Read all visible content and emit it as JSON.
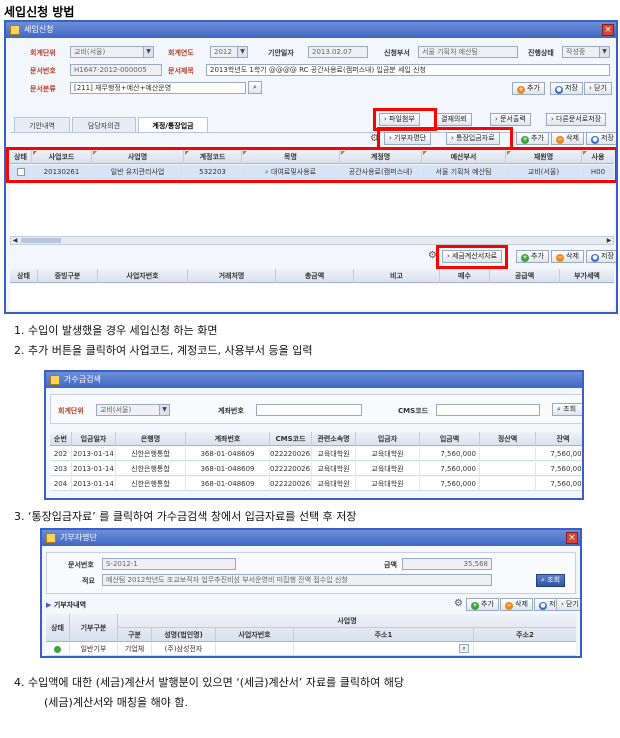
{
  "doc_title": "세입신청 방법",
  "main_window": {
    "title": "세입신청",
    "fields": {
      "unit_label": "회계단위",
      "unit_value": "교비(서울)",
      "year_label": "회계연도",
      "year_value": "2012",
      "date_label": "기안일자",
      "date_value": "2013.02.07",
      "dept_label": "신청부서",
      "dept_value": "서울 기획처 예산팀",
      "status_label": "진행상태",
      "status_value": "작성중",
      "docno_label": "문서번호",
      "docno_value": "H1647-2012-000005",
      "subject_label": "문서제목",
      "subject_value": "2013학년도 1학기 @@@@ RC 공간사용료(캠퍼스내) 입금분 세입 신청",
      "class_label": "문서분류",
      "class_value": "[211] 재무행정+예산+예산운영"
    },
    "buttons": {
      "add": "추가",
      "save": "저장",
      "close": "닫기",
      "attach": "파일첨부",
      "approval": "결재의뢰",
      "print": "문서출력",
      "other_save": "다른문서로저장",
      "donor": "기부자명단",
      "deposit": "통장입금자료",
      "grid_add": "추가",
      "grid_delete": "삭제",
      "grid_save": "저장",
      "tax": "세금계산서자료",
      "tax_add": "추가",
      "tax_delete": "삭제",
      "tax_save": "저장"
    },
    "tabs": [
      "기안내역",
      "담당자의견",
      "계정/통장입금"
    ],
    "grid_headers": [
      "상태",
      "사업코드",
      "사업명",
      "계정코드",
      "목명",
      "계정명",
      "예산부서",
      "재원명",
      "사용"
    ],
    "grid_row": [
      "",
      "20130261",
      "일반 유지관리사업",
      "532203",
      "대여료및사용료",
      "공간사용료(캠퍼스내)",
      "서울 기획처 예산팀",
      "교비(서울)",
      "H00"
    ],
    "tax_headers": [
      "상태",
      "증빙구분",
      "사업자번호",
      "거래처명",
      "총금액",
      "비고",
      "매수",
      "공급액",
      "부가세액"
    ]
  },
  "steps": {
    "s1": "1. 수입이 발생했을 경우 세입신청 하는 화면",
    "s2": "2. 추가 버튼을 클릭하여 사업코드, 계정코드, 사용부서 등을 입력",
    "s3": "3. ‘통장입금자료’ 를 클릭하여 가수금검색 창에서 입금자료를 선택 후 저장",
    "s4a": "4. 수입액에 대한 (세금)계산서 발행분이 있으면 ‘(세금)계산서’ 자료를 클릭하여 해당",
    "s4b": "(세금)계산서와 매칭을 해야 함."
  },
  "suspense_window": {
    "title": "가수금검색",
    "unit_label": "회계단위",
    "unit_value": "교비(서울)",
    "account_label": "계좌번호",
    "cms_label": "CMS코드",
    "search": "조회",
    "headers": [
      "순번",
      "입금일자",
      "은행명",
      "계좌번호",
      "CMS코드",
      "관련소속명",
      "입금자",
      "입금액",
      "정산액",
      "잔액"
    ],
    "rows": [
      [
        "202",
        "2013-01-14",
        "신한은행통합",
        "368-01-048609",
        "0222200262",
        "교육대학원",
        "교육대학원",
        "7,560,000",
        "",
        "7,560,000"
      ],
      [
        "203",
        "2013-01-14",
        "신한은행통합",
        "368-01-048609",
        "0222200262",
        "교육대학원",
        "교육대학원",
        "7,560,000",
        "",
        "7,560,000"
      ],
      [
        "204",
        "2013-01-14",
        "신한은행통합",
        "368-01-048609",
        "0222200262",
        "교육대학원",
        "교육대학원",
        "7,560,000",
        "",
        "7,560,000"
      ]
    ]
  },
  "donor_window": {
    "title": "기부자명단",
    "docno_label": "문서번호",
    "docno_value": "S-2012-1",
    "amount_label": "금액",
    "amount_value": "35,568",
    "summary_label": "적요",
    "summary_value": "예산팀 2012학년도 조교보직자 업무추진비성 부서운영비 미집행 잔액 접수입 신청",
    "search": "조회",
    "section": "기부자내역",
    "btn_add": "추가",
    "btn_delete": "삭제",
    "btn_save": "저장",
    "btn_close": "닫기",
    "top_header": "사업명",
    "headers": [
      "상태",
      "기부구분",
      "구분",
      "성명(법인명)",
      "사업자번호",
      "주소1",
      "주소2"
    ],
    "row": [
      "",
      "일반기부",
      "기업체",
      "(주)삼성전자",
      "",
      "",
      ""
    ]
  },
  "colors": {
    "highlight": "#ff0000",
    "window_border": "#3a5fcd",
    "label": "#b5422d"
  }
}
